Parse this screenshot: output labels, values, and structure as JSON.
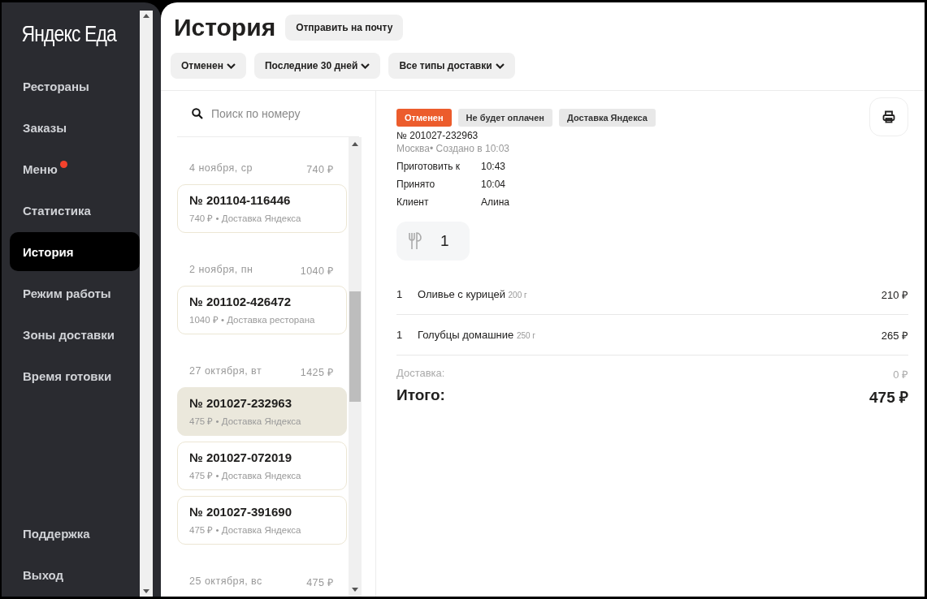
{
  "sidebar": {
    "logo": "Яндекс Еда",
    "items": [
      {
        "label": "Рестораны",
        "selected": false,
        "dot": false
      },
      {
        "label": "Заказы",
        "selected": false,
        "dot": false
      },
      {
        "label": "Меню",
        "selected": false,
        "dot": true
      },
      {
        "label": "Статистика",
        "selected": false,
        "dot": false
      },
      {
        "label": "История",
        "selected": true,
        "dot": false
      },
      {
        "label": "Режим работы",
        "selected": false,
        "dot": false
      },
      {
        "label": "Зоны доставки",
        "selected": false,
        "dot": false
      },
      {
        "label": "Время готовки",
        "selected": false,
        "dot": false
      }
    ],
    "footer_items": [
      {
        "label": "Поддержка",
        "selected": false
      },
      {
        "label": "Выход",
        "selected": false
      }
    ]
  },
  "header": {
    "title": "История",
    "send_button": "Отправить на почту",
    "filters": [
      "Отменен",
      "Последние 30 дней",
      "Все типы доставки"
    ]
  },
  "orders_list": {
    "search": {
      "placeholder": "Поиск по номеру"
    },
    "groups": [
      {
        "date": "4 ноября, ср",
        "total": "740 ₽",
        "orders": [
          {
            "number": "№ 201104-116446",
            "summary": "740 ₽ • Доставка Яндекса",
            "selected": false
          }
        ]
      },
      {
        "date": "2 ноября, пн",
        "total": "1040 ₽",
        "orders": [
          {
            "number": "№ 201102-426472",
            "summary": "1040 ₽ • Доставка ресторана",
            "selected": false
          }
        ]
      },
      {
        "date": "27 октября, вт",
        "total": "1425 ₽",
        "orders": [
          {
            "number": "№ 201027-232963",
            "summary": "475 ₽ • Доставка Яндекса",
            "selected": true
          },
          {
            "number": "№ 201027-072019",
            "summary": "475 ₽ • Доставка Яндекса",
            "selected": false
          },
          {
            "number": "№ 201027-391690",
            "summary": "475 ₽ • Доставка Яндекса",
            "selected": false
          }
        ]
      },
      {
        "date": "25 октября, вс",
        "total": "475 ₽"
      }
    ]
  },
  "detail": {
    "tags": [
      {
        "label": "Отменен",
        "kind": "status"
      },
      {
        "label": "Не будет оплачен",
        "kind": "plain"
      },
      {
        "label": "Доставка Яндекса",
        "kind": "plain"
      }
    ],
    "number": "№ 201027-232963",
    "meta": "Москва• Создано в 10:03",
    "fields": [
      {
        "label": "Приготовить к",
        "value": "10:43"
      },
      {
        "label": "Принято",
        "value": "10:04"
      },
      {
        "label": "Клиент",
        "value": "Алина"
      }
    ],
    "cutlery": "1",
    "items": [
      {
        "qty": "1",
        "name": "Оливье с курицей",
        "weight": "200 г",
        "price": "210 ₽"
      },
      {
        "qty": "1",
        "name": "Голубцы домашние",
        "weight": "250 г",
        "price": "265 ₽"
      }
    ],
    "delivery": {
      "label": "Доставка:",
      "value": "0 ₽"
    },
    "total": {
      "label": "Итого:",
      "value": "475 ₽"
    }
  }
}
